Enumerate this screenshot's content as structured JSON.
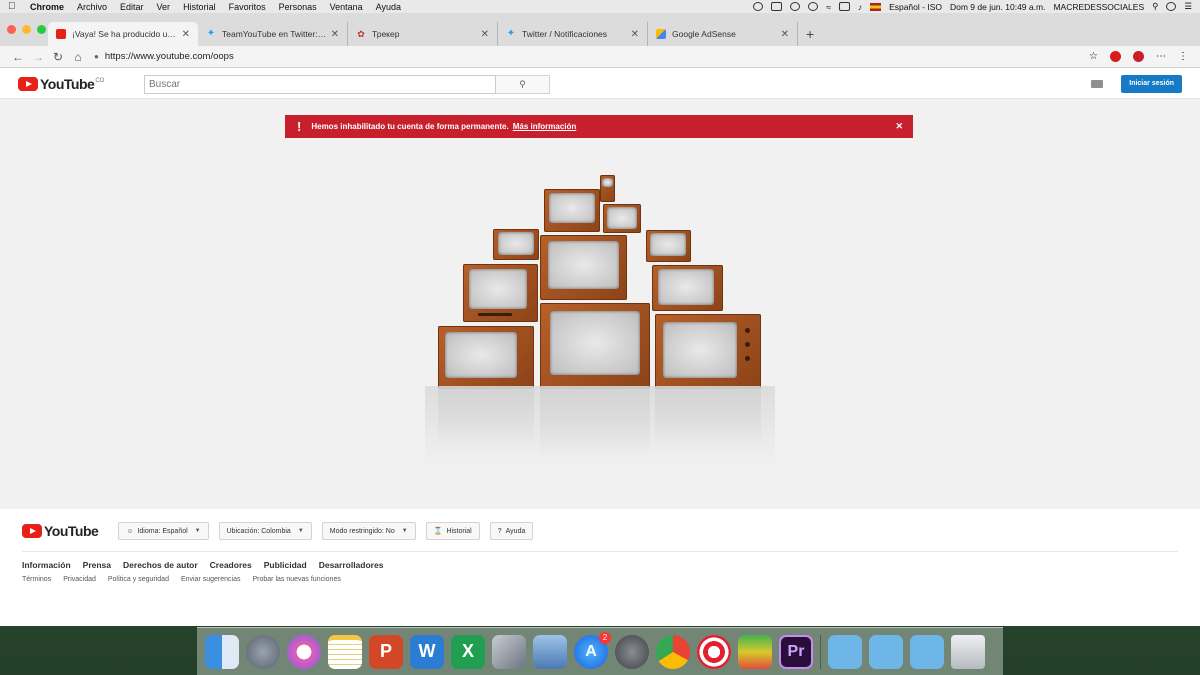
{
  "menubar": {
    "items": [
      "Chrome",
      "Archivo",
      "Editar",
      "Ver",
      "Historial",
      "Favoritos",
      "Personas",
      "Ventana",
      "Ayuda"
    ],
    "keyboard": "Español - ISO",
    "clock": "Dom 9 de jun.  10:49 a.m.",
    "user": "MACREDESSOCIALES"
  },
  "browser": {
    "tabs": [
      {
        "title": "¡Vaya! Se ha producido un error",
        "icon": "youtube-icon"
      },
      {
        "title": "TeamYouTube en Twitter: \"Any",
        "icon": "twitter-icon"
      },
      {
        "title": "Трекер",
        "icon": "tracker-icon"
      },
      {
        "title": "Twitter / Notificaciones",
        "icon": "twitter-icon"
      },
      {
        "title": "Google AdSense",
        "icon": "adsense-icon"
      }
    ],
    "url": "https://www.youtube.com/oops"
  },
  "youtube": {
    "logo_text": "YouTube",
    "country_code": "CO",
    "search_placeholder": "Buscar",
    "signin_label": "Iniciar sesión",
    "alert_text": "Hemos inhabilitado tu cuenta de forma permanente.",
    "alert_link": "Más información",
    "footer": {
      "language": "Idioma: Español",
      "location": "Ubicación: Colombia",
      "restricted": "Modo restringido: No",
      "history": "Historial",
      "help": "Ayuda",
      "links_primary": [
        "Información",
        "Prensa",
        "Derechos de autor",
        "Creadores",
        "Publicidad",
        "Desarrolladores"
      ],
      "links_secondary": [
        "Términos",
        "Privacidad",
        "Política y seguridad",
        "Enviar sugerencias",
        "Probar las nuevas funciones"
      ]
    }
  },
  "dock": {
    "appstore_badge": "2",
    "icons": [
      "finder-icon",
      "launchpad-icon",
      "itunes-icon",
      "notes-icon",
      "powerpoint-icon",
      "word-icon",
      "excel-icon",
      "directory-utility-icon",
      "preview-icon",
      "app-store-icon",
      "system-preferences-icon",
      "chrome-icon",
      "target-icon",
      "bluestacks-icon",
      "premiere-icon",
      "applications-folder-icon",
      "documents-folder-icon",
      "downloads-folder-icon",
      "trash-icon"
    ]
  },
  "colors": {
    "youtube_red": "#e62117",
    "alert_red": "#c7202c",
    "signin_blue": "#167ac6"
  }
}
